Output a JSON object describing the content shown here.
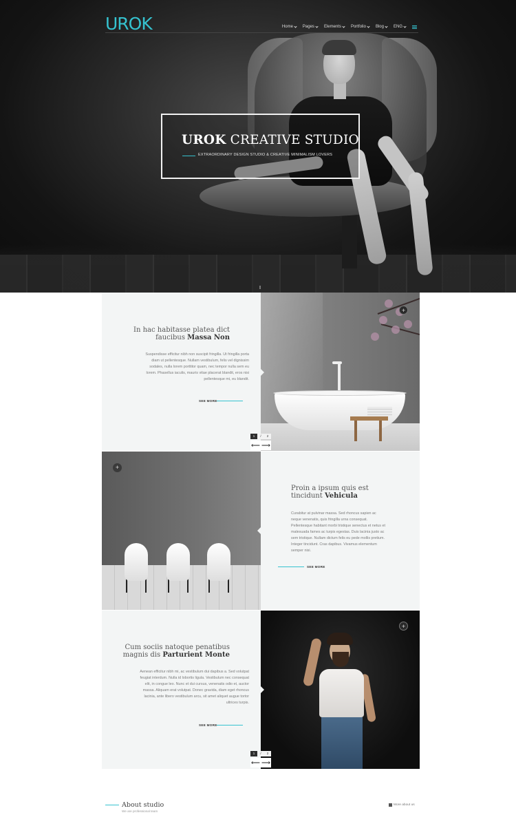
{
  "brand": {
    "logo": "UROK",
    "accent": "#35c2cf"
  },
  "nav": {
    "items": [
      {
        "label": "Home"
      },
      {
        "label": "Pages"
      },
      {
        "label": "Elements"
      },
      {
        "label": "Portfolio"
      },
      {
        "label": "Blog"
      },
      {
        "label": "ENG"
      }
    ],
    "menu_icon": "menu-icon"
  },
  "hero": {
    "title_bold": "UROK",
    "title_rest": " CREATIVE STUDIO",
    "subtitle": "EXTRAORDINARY DESIGN STUDIO & CREATIVE MINIMALISM LOVERS"
  },
  "features": [
    {
      "title_line1": "In hac habitasse platea dict",
      "title_line2": "faucibus ",
      "title_bold": "Massa Non",
      "body": "Suspendisse efficitur nibh non suscipit fringilla. Ut fringilla porta diam ut pellentesque. Nullam vestibulum, felis vel dignissim sodales, nulla lorem porttitor quam, nec tempor nulla sem eu lorem. Phasellus iaculis, mauris vitae placerat blandit, eros nisi pellentesque mi, eu blandit.",
      "see_more": "SEE MORE",
      "pager": [
        "1",
        "/",
        "2"
      ]
    },
    {
      "title_line1": "Proin a ipsum quis est",
      "title_line2": "tincidunt ",
      "title_bold": "Vehicula",
      "body": "Curabitur at pulvinar massa. Sed rhoncus sapien ac neque venenatis, quis fringilla urna consequat. Pellentesque habitant morbi tristique senectus et netus et malesuada fames ac turpis egestas. Duis lacinia justo ac sem tristique. Nullam dictum felis eu pede mollis pretium. Integer tincidunt. Cras dapibus. Vivamus elementum semper nisi.",
      "see_more": "SEE MORE"
    },
    {
      "title_line1": "Cum sociis natoque penatibus",
      "title_line2": "magnis dis ",
      "title_bold": "Parturient Monte",
      "body": "Aenean efficitur nibh mi, ac vestibulum dui dapibus a. Sed volutpat feugiat interdum. Nulla id lobortis ligula. Vestibulum nec consequat elit, in congue leo. Nunc et dui cursus, venenatis odio et, auctor massa. Aliquam erat volutpat. Donec gravida, diam eget rhoncus lacinia, ante libero vestibulum arcu, sit amet aliquet augue tortor ultrices turpis.",
      "see_more": "SEE MORE",
      "pager": [
        "1",
        "/",
        "2"
      ]
    }
  ],
  "controls": {
    "plus": "+",
    "prev": "⟵",
    "next": "⟶"
  },
  "about": {
    "title": "About studio",
    "subtitle": "We are professional team",
    "more_link": "More about us"
  }
}
